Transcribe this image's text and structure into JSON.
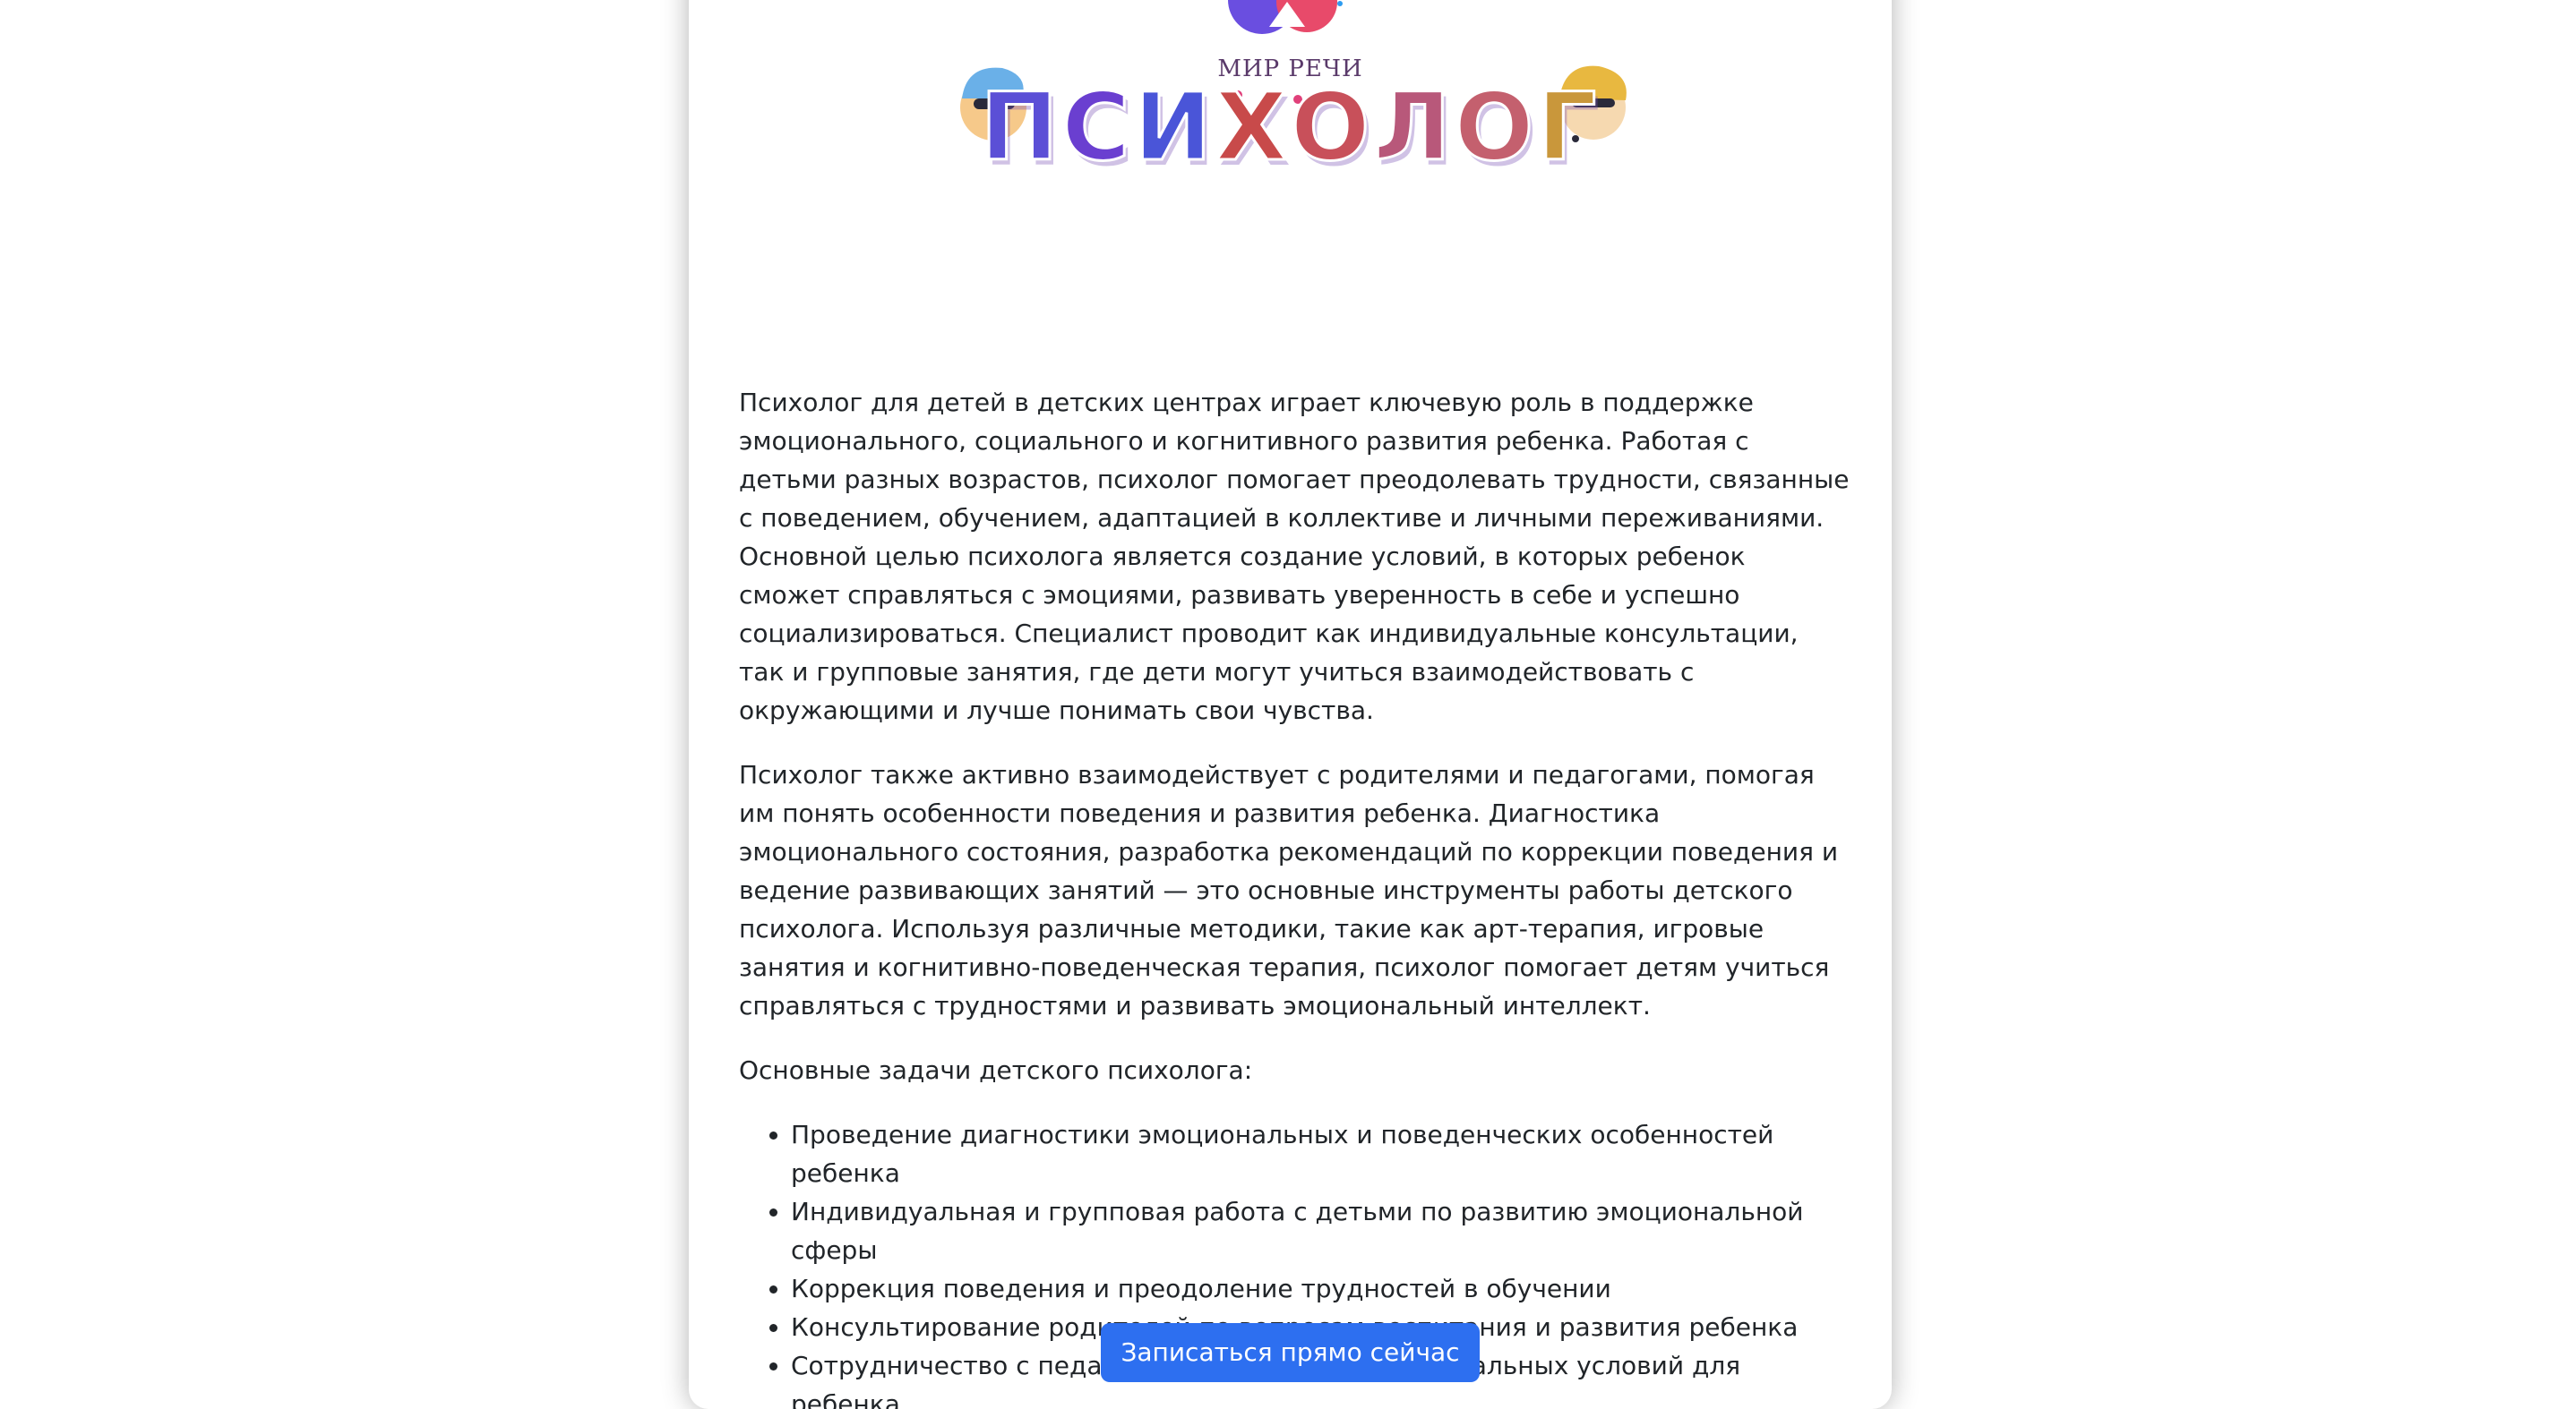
{
  "logo": {
    "caption": "МИР РЕЧИ",
    "word_letters": [
      "П",
      "С",
      "И",
      "Х",
      "О",
      "Л",
      "О",
      "Г"
    ],
    "letter_colors": [
      "#5b4fd6",
      "#6a3fd0",
      "#4a55d8",
      "#c84a4a",
      "#c8505a",
      "#b8587a",
      "#c4606e",
      "#c9973b"
    ]
  },
  "paragraphs": [
    "Психолог для детей в детских центрах играет ключевую роль в поддержке эмоционального, социального и когнитивного развития ребенка. Работая с детьми разных возрастов, психолог помогает преодолевать трудности, связанные с поведением, обучением, адаптацией в коллективе и личными переживаниями. Основной целью психолога является создание условий, в которых ребенок сможет справляться с эмоциями, развивать уверенность в себе и успешно социализироваться. Специалист проводит как индивидуальные консультации, так и групповые занятия, где дети могут учиться взаимодействовать с окружающими и лучше понимать свои чувства.",
    "Психолог также активно взаимодействует с родителями и педагогами, помогая им понять особенности поведения и развития ребенка. Диагностика эмоционального состояния, разработка рекомендаций по коррекции поведения и ведение развивающих занятий — это основные инструменты работы детского психолога. Используя различные методики, такие как арт-терапия, игровые занятия и когнитивно-поведенческая терапия, психолог помогает детям учиться справляться с трудностями и развивать эмоциональный интеллект.",
    "Основные задачи детского психолога:"
  ],
  "tasks": [
    "Проведение диагностики эмоциональных и поведенческих особенностей ребенка",
    "Индивидуальная и групповая работа с детьми по развитию эмоциональной сферы",
    "Коррекция поведения и преодоление трудностей в обучении",
    "Консультирование родителей по вопросам воспитания и развития ребенка",
    "Сотрудничество с педагогами для создания оптимальных условий для ребенка"
  ],
  "cta": {
    "label": "Записаться прямо сейчас",
    "color": "#2d6ff0"
  }
}
